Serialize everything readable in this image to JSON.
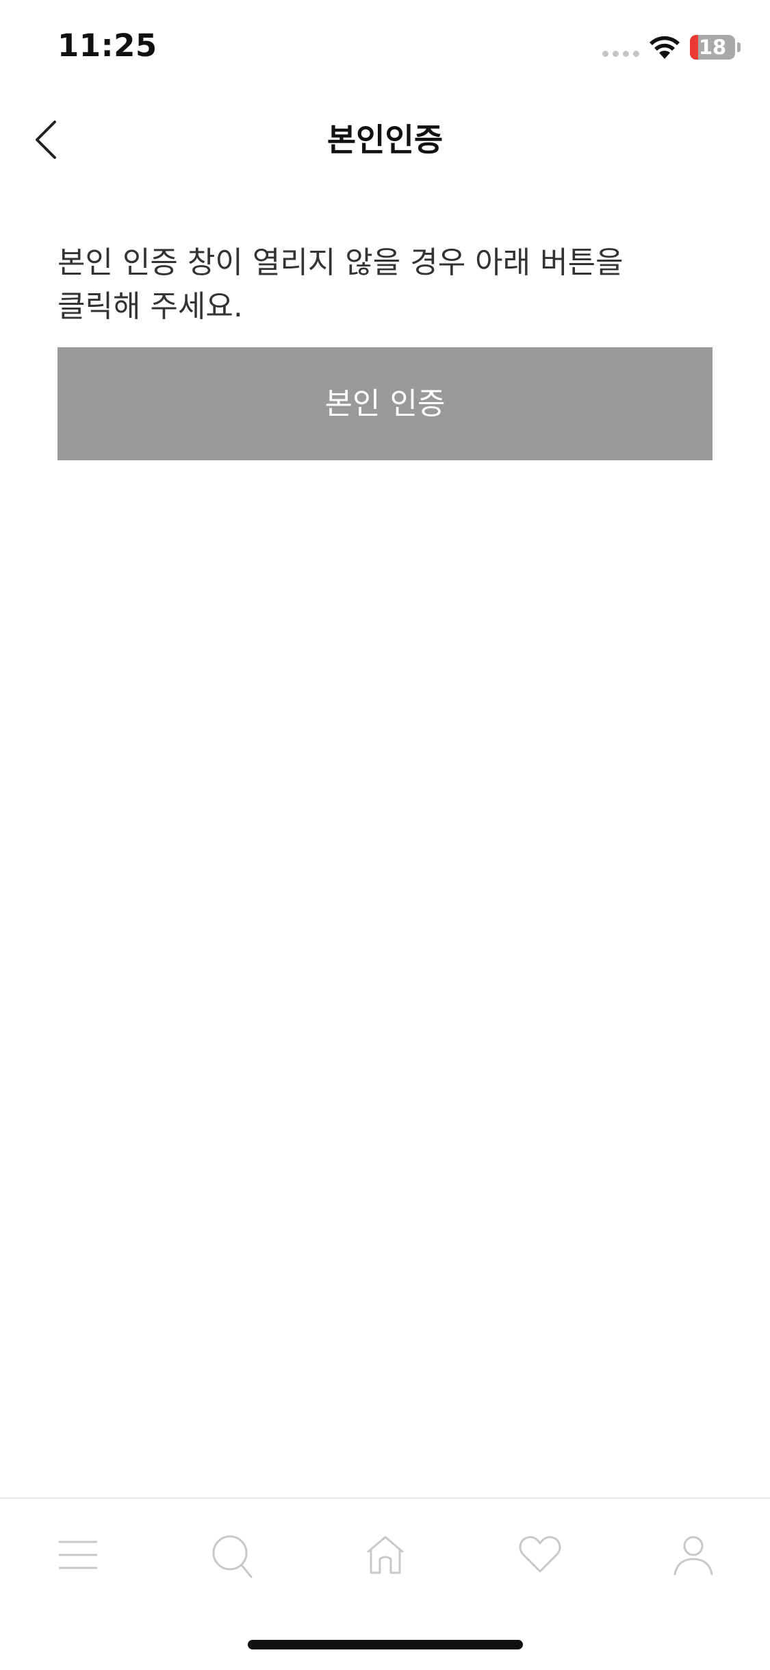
{
  "status_bar": {
    "time": "11:25",
    "battery_level": "18",
    "battery_fraction": 0.18
  },
  "header": {
    "title": "본인인증",
    "back_icon": "chevron-left-icon"
  },
  "main": {
    "notice": "본인 인증 창이 열리지 않을 경우 아래 버튼을 클릭해 주세요.",
    "verify_button_label": "본인 인증",
    "verify_button_color": "#999999"
  },
  "tab_bar": {
    "items": [
      {
        "icon": "menu-icon"
      },
      {
        "icon": "search-icon"
      },
      {
        "icon": "home-icon"
      },
      {
        "icon": "heart-icon"
      },
      {
        "icon": "person-icon"
      }
    ],
    "icon_color": "#c8c8c8"
  }
}
